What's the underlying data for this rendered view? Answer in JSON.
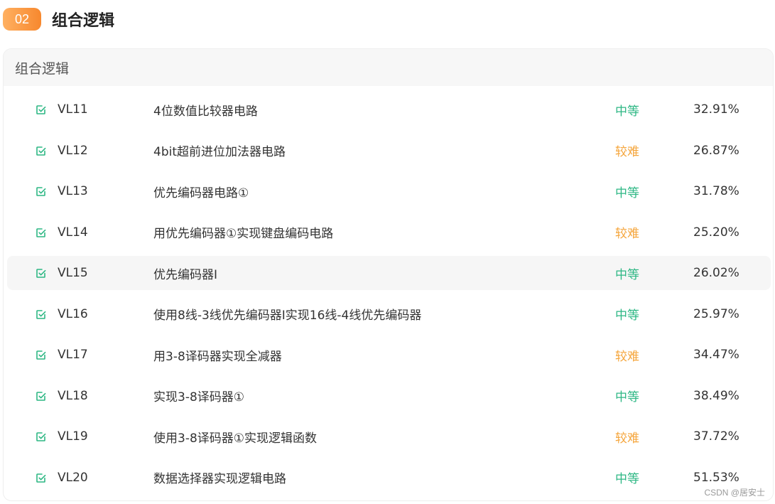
{
  "section": {
    "badge": "02",
    "title": "组合逻辑"
  },
  "card": {
    "header": "组合逻辑"
  },
  "colors": {
    "medium": "#2db784",
    "hard": "#f5a53b",
    "accent": "#f7882e",
    "check": "#2db784"
  },
  "problems": [
    {
      "code": "VL11",
      "title": "4位数值比较器电路",
      "difficulty": "中等",
      "level": "medium",
      "rate": "32.91%"
    },
    {
      "code": "VL12",
      "title": "4bit超前进位加法器电路",
      "difficulty": "较难",
      "level": "hard",
      "rate": "26.87%"
    },
    {
      "code": "VL13",
      "title": "优先编码器电路①",
      "difficulty": "中等",
      "level": "medium",
      "rate": "31.78%"
    },
    {
      "code": "VL14",
      "title": "用优先编码器①实现键盘编码电路",
      "difficulty": "较难",
      "level": "hard",
      "rate": "25.20%"
    },
    {
      "code": "VL15",
      "title": "优先编码器Ⅰ",
      "difficulty": "中等",
      "level": "medium",
      "rate": "26.02%",
      "hovered": true
    },
    {
      "code": "VL16",
      "title": "使用8线-3线优先编码器Ⅰ实现16线-4线优先编码器",
      "difficulty": "中等",
      "level": "medium",
      "rate": "25.97%"
    },
    {
      "code": "VL17",
      "title": "用3-8译码器实现全减器",
      "difficulty": "较难",
      "level": "hard",
      "rate": "34.47%"
    },
    {
      "code": "VL18",
      "title": "实现3-8译码器①",
      "difficulty": "中等",
      "level": "medium",
      "rate": "38.49%"
    },
    {
      "code": "VL19",
      "title": "使用3-8译码器①实现逻辑函数",
      "difficulty": "较难",
      "level": "hard",
      "rate": "37.72%"
    },
    {
      "code": "VL20",
      "title": "数据选择器实现逻辑电路",
      "difficulty": "中等",
      "level": "medium",
      "rate": "51.53%"
    }
  ],
  "watermark": "CSDN @居安士"
}
